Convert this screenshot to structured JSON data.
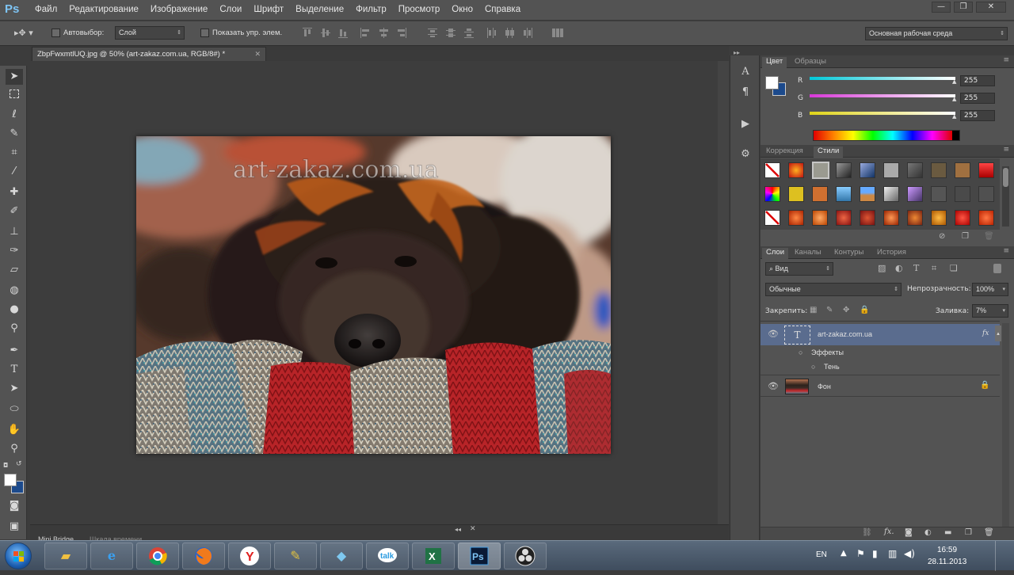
{
  "app": {
    "logo": "Ps"
  },
  "menubar": {
    "items": [
      "Файл",
      "Редактирование",
      "Изображение",
      "Слои",
      "Шрифт",
      "Выделение",
      "Фильтр",
      "Просмотр",
      "Окно",
      "Справка"
    ],
    "window_controls": [
      "—",
      "❐",
      "✕"
    ]
  },
  "options": {
    "auto_select_label": "Автовыбор:",
    "auto_select_value": "Слой",
    "show_controls_label": "Показать упр. элем.",
    "workspace": "Основная рабочая среда"
  },
  "document": {
    "tab_title": "ZbpFwxmtlUQ.jpg @ 50% (art-zakaz.com.ua, RGB/8#) *",
    "watermark": "art-zakaz.com.ua"
  },
  "minibridge": {
    "tabs": [
      "Mini Bridge",
      "Шкала времени"
    ]
  },
  "color_panel": {
    "tabs": [
      "Цвет",
      "Образцы"
    ],
    "channels": [
      {
        "label": "R",
        "value": "255",
        "color": "#00d4e0"
      },
      {
        "label": "G",
        "value": "255",
        "color": "#e040e0"
      },
      {
        "label": "B",
        "value": "255",
        "color": "#e8e020"
      }
    ]
  },
  "styles_panel": {
    "tabs": [
      "Коррекция",
      "Стили"
    ]
  },
  "layers_panel": {
    "tabs": [
      "Слои",
      "Каналы",
      "Контуры",
      "История"
    ],
    "filter_kind": "Вид",
    "blend_mode": "Обычные",
    "opacity_label": "Непрозрачность:",
    "opacity_value": "100%",
    "lock_label": "Закрепить:",
    "fill_label": "Заливка:",
    "fill_value": "7%",
    "layers": [
      {
        "name": "art-zakaz.com.ua",
        "type": "text",
        "effects_label": "Эффекты",
        "effect": "Тень",
        "fx": "fx"
      },
      {
        "name": "Фон",
        "type": "image"
      }
    ]
  },
  "taskbar": {
    "language": "EN",
    "time": "16:59",
    "date": "28.11.2013"
  }
}
